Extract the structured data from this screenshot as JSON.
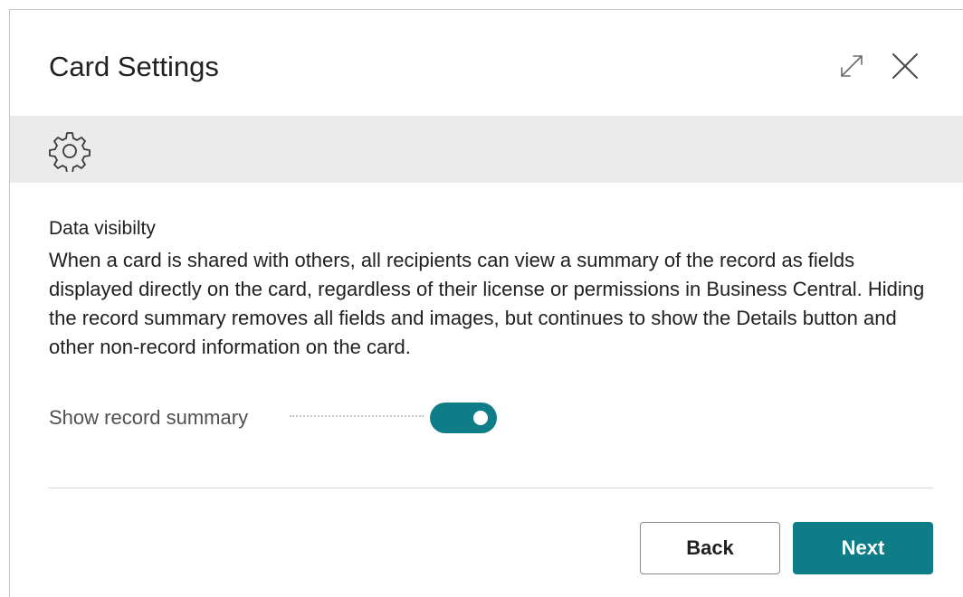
{
  "dialog": {
    "title": "Card Settings",
    "expand_icon": "expand-diagonal-icon",
    "close_icon": "close-icon",
    "banner_icon": "gear-icon"
  },
  "section": {
    "title": "Data visibilty",
    "description": "When a card is shared with others, all recipients can view a summary of the record as fields displayed directly on the card, regardless of their license or permissions in Business Central. Hiding the record summary removes all fields and images, but continues to show the Details button and other non-record information on the card."
  },
  "toggle": {
    "label": "Show record summary",
    "on": true
  },
  "footer": {
    "back_label": "Back",
    "next_label": "Next"
  },
  "colors": {
    "accent": "#0f7d88",
    "banner_bg": "#ebebeb",
    "text": "#212121"
  }
}
